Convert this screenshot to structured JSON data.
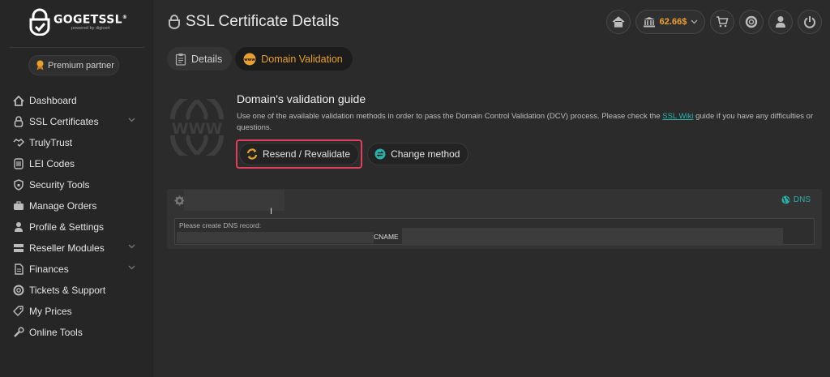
{
  "brand": {
    "name": "GOGETSSL",
    "registered": "®",
    "sub": "powered by digicert"
  },
  "partner": {
    "label": "Premium partner"
  },
  "sidebar": {
    "items": [
      {
        "label": "Dashboard",
        "icon": "home-icon",
        "expandable": false
      },
      {
        "label": "SSL Certificates",
        "icon": "lock-icon",
        "expandable": true
      },
      {
        "label": "TrulyTrust",
        "icon": "handshake-icon",
        "expandable": false
      },
      {
        "label": "LEI Codes",
        "icon": "barcode-icon",
        "expandable": false
      },
      {
        "label": "Security Tools",
        "icon": "shield-icon",
        "expandable": false
      },
      {
        "label": "Manage Orders",
        "icon": "briefcase-icon",
        "expandable": false
      },
      {
        "label": "Profile & Settings",
        "icon": "user-icon",
        "expandable": false
      },
      {
        "label": "Reseller Modules",
        "icon": "stack-icon",
        "expandable": true
      },
      {
        "label": "Finances",
        "icon": "document-icon",
        "expandable": true
      },
      {
        "label": "Tickets & Support",
        "icon": "lifebuoy-icon",
        "expandable": false
      },
      {
        "label": "My Prices",
        "icon": "tags-icon",
        "expandable": false
      },
      {
        "label": "Online Tools",
        "icon": "wrench-icon",
        "expandable": false
      }
    ]
  },
  "header": {
    "title": "SSL Certificate Details",
    "balance": "62.66$",
    "icons": [
      "home-icon",
      "bank-icon",
      "cart-icon",
      "lifebuoy-icon",
      "user-icon",
      "power-icon"
    ]
  },
  "tabs": [
    {
      "label": "Details",
      "active": false
    },
    {
      "label": "Domain Validation",
      "active": true
    }
  ],
  "guide": {
    "title": "Domain's validation guide",
    "text_before": "Use one of the available validation methods in order to pass the Domain Control Validation (DCV) process. Please check the ",
    "link": "SSL Wiki",
    "text_after": " guide if you have any difficulties or questions.",
    "resend_label": "Resend / Revalidate",
    "change_label": "Change method"
  },
  "dns_panel": {
    "method": "DNS",
    "record_label": "Please create DNS record:",
    "record_type": "CNAME",
    "cursor": "I"
  },
  "colors": {
    "accent": "#e8a030",
    "teal": "#2ab0a8",
    "highlight": "#e0405c",
    "background": "#2b2b2b",
    "sidebar": "#262626"
  }
}
